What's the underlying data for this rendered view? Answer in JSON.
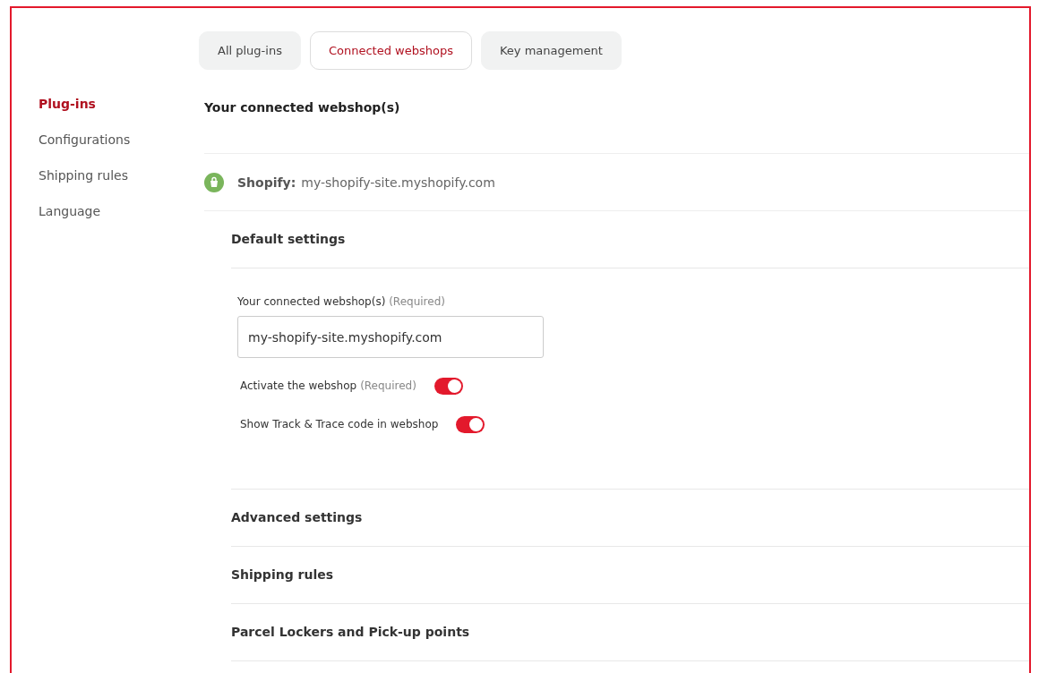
{
  "sidebar": {
    "items": [
      {
        "label": "Plug-ins",
        "selected": true
      },
      {
        "label": "Configurations",
        "selected": false
      },
      {
        "label": "Shipping rules",
        "selected": false
      },
      {
        "label": "Language",
        "selected": false
      }
    ]
  },
  "tabs": [
    {
      "label": "All plug-ins",
      "selected": false
    },
    {
      "label": "Connected webshops",
      "selected": true
    },
    {
      "label": "Key management",
      "selected": false
    }
  ],
  "heading": "Your connected webshop(s)",
  "webshop": {
    "platform": "Shopify:",
    "address": "my-shopify-site.myshopify.com"
  },
  "default_settings": {
    "title": "Default settings",
    "field": {
      "label": "Your connected webshop(s)",
      "note": "(Required)",
      "value": "my-shopify-site.myshopify.com"
    },
    "toggles": [
      {
        "label": "Activate the webshop",
        "note": "(Required)",
        "on": true
      },
      {
        "label": "Show Track & Trace code in webshop",
        "on": true
      }
    ]
  },
  "sections": [
    "Advanced settings",
    "Shipping rules",
    "Parcel Lockers and Pick-up points"
  ]
}
